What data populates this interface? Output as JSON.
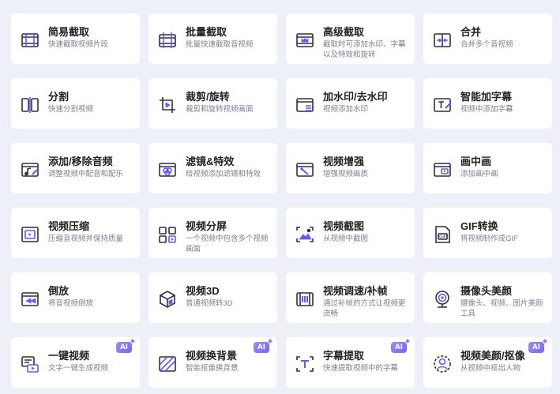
{
  "colors": {
    "background": "#eef0f8",
    "card": "#ffffff",
    "accent": "#6b57f5",
    "icon_stroke": "#2f2f45",
    "title": "#222222",
    "desc": "#7b8090"
  },
  "tools": [
    {
      "key": "simple-cut",
      "icon": "film-strip-icon",
      "title": "简易截取",
      "desc": "快速截取视频片段",
      "ai": ""
    },
    {
      "key": "batch-cut",
      "icon": "batch-film-icon",
      "title": "批量截取",
      "desc": "批量快速截取音视频",
      "ai": ""
    },
    {
      "key": "advanced-cut",
      "icon": "crown-film-icon",
      "title": "高级截取",
      "desc": "截取时可添加水印、字幕以及特效和旋转",
      "ai": ""
    },
    {
      "key": "merge",
      "icon": "merge-icon",
      "title": "合并",
      "desc": "合并多个音视频",
      "ai": ""
    },
    {
      "key": "split",
      "icon": "split-icon",
      "title": "分割",
      "desc": "快速分割视频",
      "ai": ""
    },
    {
      "key": "crop-rotate",
      "icon": "crop-rotate-icon",
      "title": "裁剪/旋转",
      "desc": "裁剪和旋转视频画面",
      "ai": ""
    },
    {
      "key": "watermark",
      "icon": "watermark-icon",
      "title": "加水印/去水印",
      "desc": "视频添加水印",
      "ai": ""
    },
    {
      "key": "auto-subtitle",
      "icon": "subtitle-icon",
      "title": "智能加字幕",
      "desc": "视频中添加字幕",
      "ai": ""
    },
    {
      "key": "audio",
      "icon": "music-note-icon",
      "title": "添加/移除音频",
      "desc": "调整视频中配音和配乐",
      "ai": ""
    },
    {
      "key": "filter",
      "icon": "filter-icon",
      "title": "滤镜&特效",
      "desc": "给视频添加滤镜和特效",
      "ai": ""
    },
    {
      "key": "enhance",
      "icon": "magic-wand-icon",
      "title": "视频增强",
      "desc": "增强视频画质",
      "ai": ""
    },
    {
      "key": "pip",
      "icon": "picture-in-picture-icon",
      "title": "画中画",
      "desc": "添加画中画",
      "ai": ""
    },
    {
      "key": "compress",
      "icon": "compress-icon",
      "title": "视频压缩",
      "desc": "压缩音视频并保持质量",
      "ai": ""
    },
    {
      "key": "split-screen",
      "icon": "split-screen-icon",
      "title": "视频分屏",
      "desc": "一个视频中包含多个视频画面",
      "ai": ""
    },
    {
      "key": "screenshot",
      "icon": "image-capture-icon",
      "title": "视频截图",
      "desc": "从视频中截图",
      "ai": ""
    },
    {
      "key": "gif",
      "icon": "gif-icon",
      "title": "GIF转换",
      "desc": "将视频制作成GIF",
      "ai": ""
    },
    {
      "key": "reverse",
      "icon": "reverse-icon",
      "title": "倒放",
      "desc": "将音视频倒放",
      "ai": ""
    },
    {
      "key": "video-3d",
      "icon": "cube-icon",
      "title": "视频3D",
      "desc": "普通视频转3D",
      "ai": ""
    },
    {
      "key": "speed",
      "icon": "speed-icon",
      "title": "视频调速/补帧",
      "desc": "通过补帧的方式让视频更流畅",
      "ai": ""
    },
    {
      "key": "camera-beauty",
      "icon": "webcam-icon",
      "title": "摄像头美颜",
      "desc": "摄像头、视频、图片美颜工具",
      "ai": ""
    },
    {
      "key": "one-click",
      "icon": "text-to-video-icon",
      "title": "一键视频",
      "desc": "文字一键生成视频",
      "ai": "AI"
    },
    {
      "key": "bg-replace",
      "icon": "background-replace-icon",
      "title": "视频换背景",
      "desc": "智能抠像换背景",
      "ai": "AI"
    },
    {
      "key": "subtitle-extract",
      "icon": "subtitle-extract-icon",
      "title": "字幕提取",
      "desc": "快速提取视频中的字幕",
      "ai": "AI"
    },
    {
      "key": "beauty-matting",
      "icon": "portrait-matting-icon",
      "title": "视频美颜/抠像",
      "desc": "从视频中抠出人物",
      "ai": "AI"
    }
  ]
}
